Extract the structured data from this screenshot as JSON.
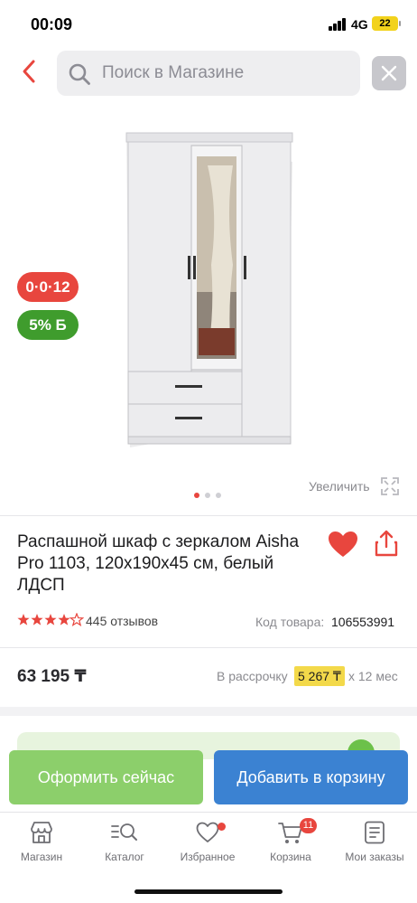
{
  "status_bar": {
    "time": "00:09",
    "network": "4G",
    "battery": "22"
  },
  "search": {
    "placeholder": "Поиск в Магазине"
  },
  "product": {
    "badges": {
      "installment": "0·0·12",
      "bonus": "5% Б"
    },
    "zoom_label": "Увеличить",
    "gallery": {
      "count": 3,
      "active": 1
    },
    "title": "Распашной шкаф с зеркалом Aisha Pro 1103, 120х190х45 см, белый ЛДСП",
    "rating": 4.5,
    "reviews": "445 отзывов",
    "sku_label": "Код товара:",
    "sku_value": "106553991",
    "price": "63 195 ₸",
    "installment": {
      "label": "В рассрочку",
      "value": "5 267 ₸",
      "term": "х 12 мес"
    }
  },
  "actions": {
    "buy_now": "Оформить сейчас",
    "add_to_cart": "Добавить в корзину"
  },
  "tabbar": {
    "items": [
      {
        "label": "Магазин",
        "icon": "store-icon"
      },
      {
        "label": "Каталог",
        "icon": "catalog-search-icon"
      },
      {
        "label": "Избранное",
        "icon": "heart-outline-icon"
      },
      {
        "label": "Корзина",
        "icon": "cart-icon",
        "badge": "11"
      },
      {
        "label": "Мои заказы",
        "icon": "orders-icon"
      }
    ]
  },
  "colors": {
    "accent_red": "#e8463e",
    "accent_green": "#3f9c2d",
    "button_blue": "#3b82d2",
    "button_green": "#8ccf6b"
  }
}
